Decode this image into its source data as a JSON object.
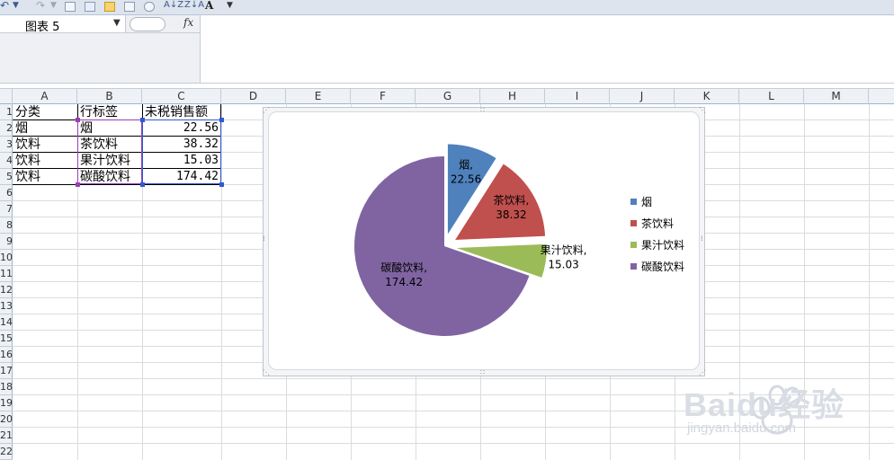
{
  "name_box": {
    "value": "图表 5"
  },
  "formula_bar": {
    "fx_label": "fx",
    "content": ""
  },
  "columns": [
    "A",
    "B",
    "C",
    "D",
    "E",
    "F",
    "G",
    "H",
    "I",
    "J",
    "K",
    "L",
    "M"
  ],
  "row_numbers": [
    "1",
    "2",
    "3",
    "4",
    "5",
    "6",
    "7",
    "8",
    "9",
    "10",
    "11",
    "12",
    "13",
    "14",
    "15",
    "16",
    "17",
    "18",
    "19",
    "20",
    "21",
    "22"
  ],
  "table": {
    "headers": [
      "分类",
      "行标签",
      "未税销售额"
    ],
    "rows": [
      [
        "烟",
        "烟",
        "22.56"
      ],
      [
        "饮料",
        "茶饮料",
        "38.32"
      ],
      [
        "饮料",
        "果汁饮料",
        "15.03"
      ],
      [
        "饮料",
        "碳酸饮料",
        "174.42"
      ]
    ]
  },
  "chart_data": {
    "type": "pie",
    "categories": [
      "烟",
      "茶饮料",
      "果汁饮料",
      "碳酸饮料"
    ],
    "values": [
      22.56,
      38.32,
      15.03,
      174.42
    ],
    "colors": [
      "#4f81bd",
      "#c0504d",
      "#9bbb59",
      "#8064a2"
    ],
    "data_labels": [
      "烟,\n22.56",
      "茶饮料,\n38.32",
      "果汁饮料,\n15.03",
      "碳酸饮料,\n174.42"
    ],
    "exploded": true,
    "legend": "right",
    "title": ""
  },
  "watermark": {
    "text": "Baidu经验",
    "subtext": "jingyan.baidu.com"
  },
  "toolbar_icons": [
    "undo-icon",
    "redo-icon",
    "borders-icon",
    "chart-icon",
    "folder-icon",
    "print-icon",
    "print-preview-icon",
    "sort-asc-icon",
    "sort-desc-icon",
    "font-color-icon",
    "more-icon"
  ]
}
